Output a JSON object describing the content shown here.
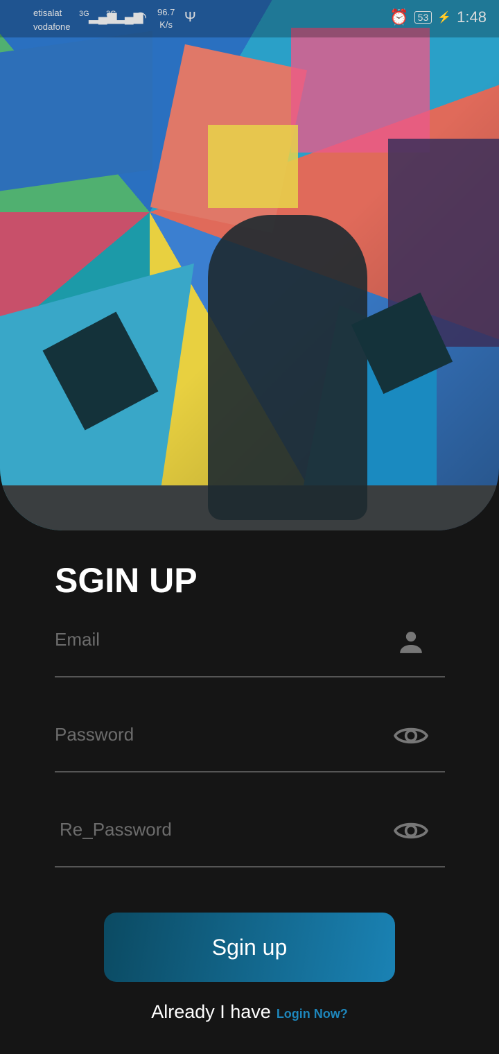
{
  "status_bar": {
    "carrier1": "etisalat",
    "carrier2": "vodafone",
    "net1": "3G",
    "net2": "3G",
    "speed_value": "96.7",
    "speed_unit": "K/s",
    "battery": "53",
    "time": "1:48"
  },
  "title": "SGIN UP",
  "fields": [
    {
      "label": "Email",
      "icon": "person-icon"
    },
    {
      "label": "Password",
      "icon": "eye-icon"
    },
    {
      "label": "Re_Password",
      "icon": "eye-icon"
    }
  ],
  "signup_button": "Sgin up",
  "footer": {
    "text": "Already I have",
    "link": "Login Now?"
  },
  "colors": {
    "accent": "#1e86bb",
    "background": "#151515"
  }
}
